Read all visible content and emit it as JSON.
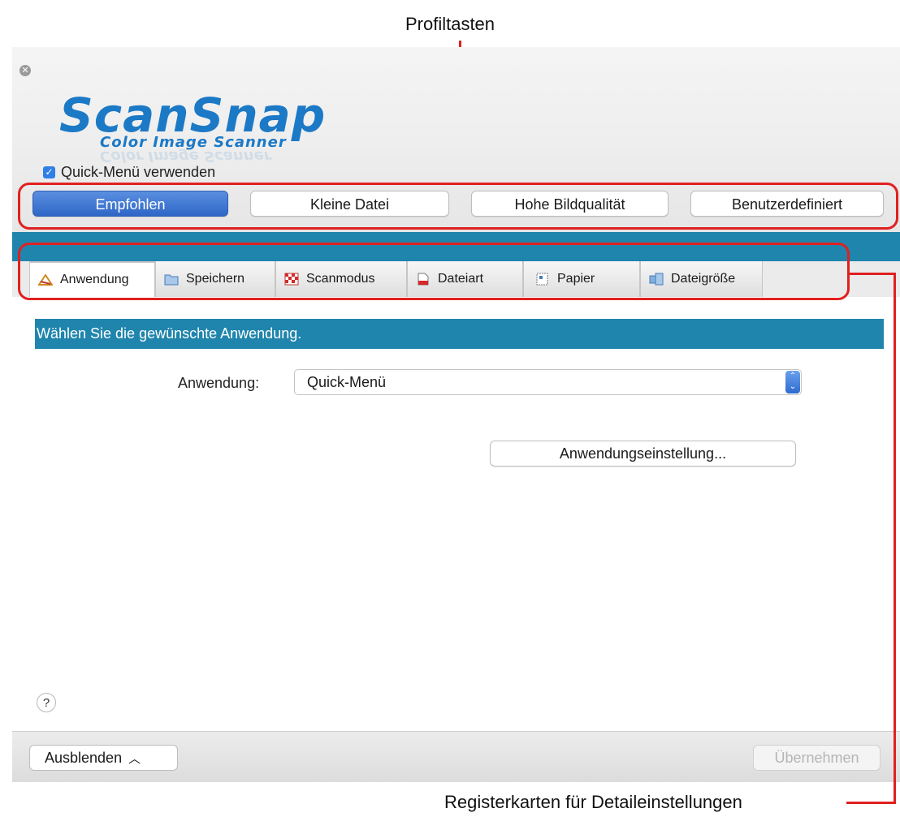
{
  "annotations": {
    "profile_keys": "Profiltasten",
    "detail_tabs": "Registerkarten für Detaileinstellungen"
  },
  "logo": {
    "name": "ScanSnap",
    "subtitle": "Color Image Scanner"
  },
  "quick_menu": {
    "label": "Quick-Menü verwenden",
    "checked": true
  },
  "profiles": [
    {
      "label": "Empfohlen",
      "active": true
    },
    {
      "label": "Kleine Datei",
      "active": false
    },
    {
      "label": "Hohe Bildqualität",
      "active": false
    },
    {
      "label": "Benutzerdefiniert",
      "active": false
    }
  ],
  "tabs": [
    {
      "label": "Anwendung",
      "icon": "application-icon",
      "active": true
    },
    {
      "label": "Speichern",
      "icon": "folder-icon",
      "active": false
    },
    {
      "label": "Scanmodus",
      "icon": "scan-mode-icon",
      "active": false
    },
    {
      "label": "Dateiart",
      "icon": "file-type-icon",
      "active": false
    },
    {
      "label": "Papier",
      "icon": "paper-icon",
      "active": false
    },
    {
      "label": "Dateigröße",
      "icon": "file-size-icon",
      "active": false
    }
  ],
  "content": {
    "header": "Wählen Sie die gewünschte Anwendung.",
    "app_label": "Anwendung:",
    "app_value": "Quick-Menü",
    "settings_button": "Anwendungseinstellung..."
  },
  "footer": {
    "help": "?",
    "hide_button": "Ausblenden",
    "apply_button": "Übernehmen"
  },
  "colors": {
    "accent_blue": "#1f85ad",
    "logo_blue": "#1c79c6",
    "callout_red": "#e02020"
  }
}
